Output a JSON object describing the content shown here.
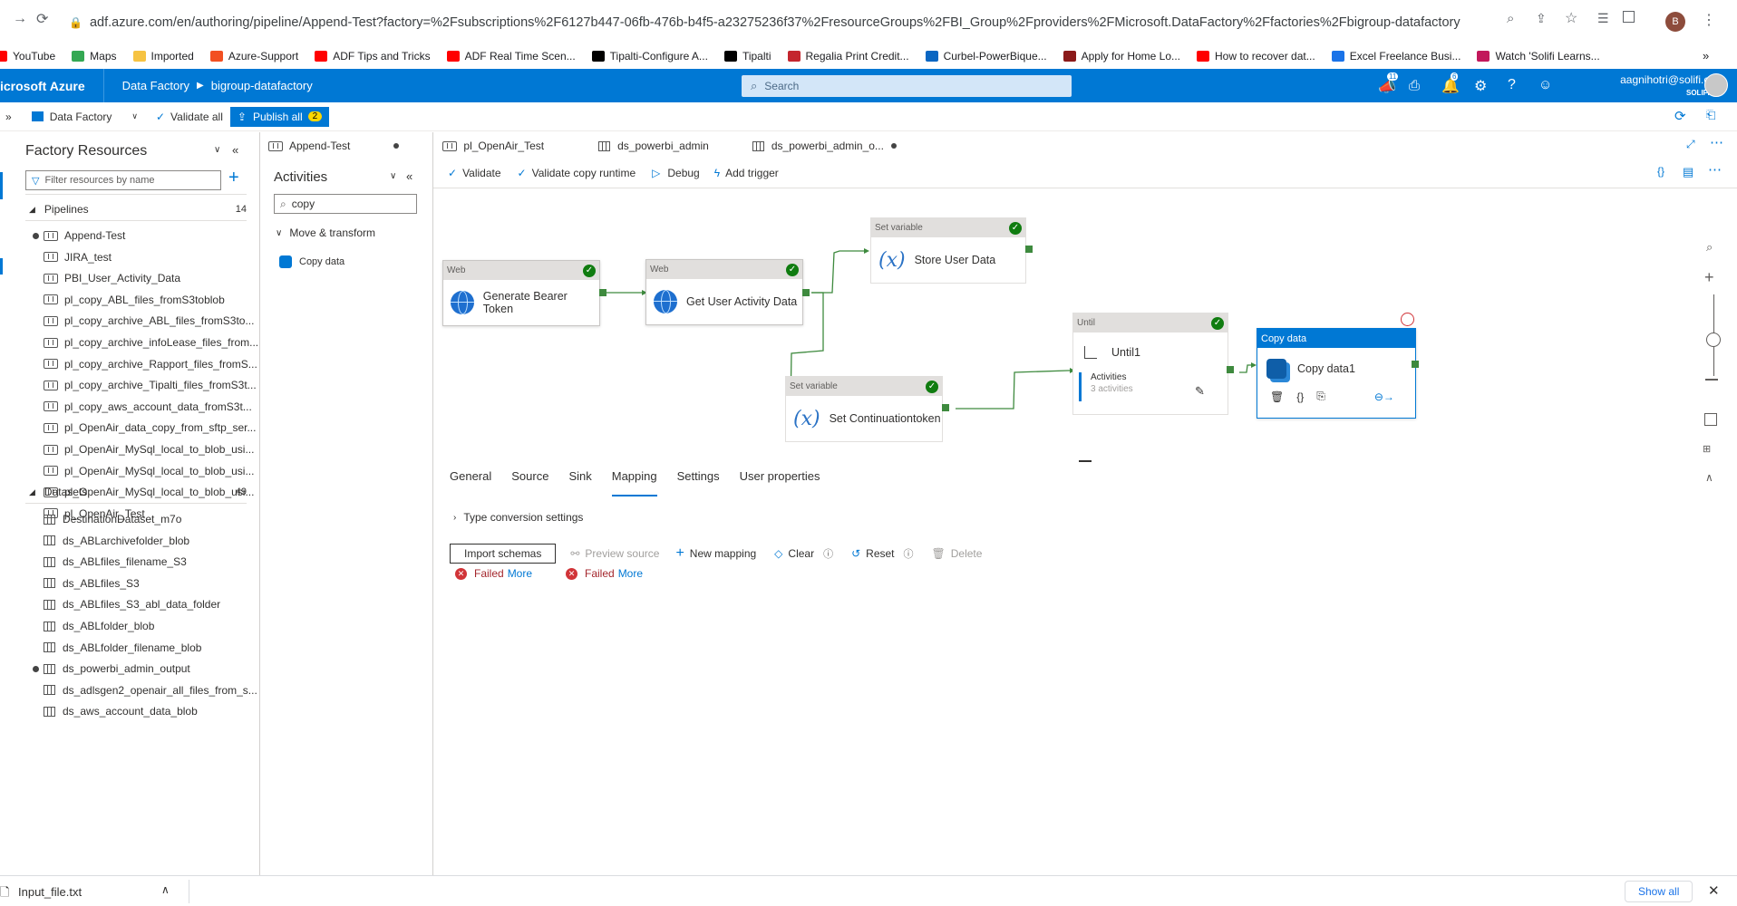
{
  "browser": {
    "url": "adf.azure.com/en/authoring/pipeline/Append-Test?factory=%2Fsubscriptions%2F6127b447-06fb-476b-b4f5-a23275236f37%2FresourceGroups%2FBI_Group%2Fproviders%2FMicrosoft.DataFactory%2Ffactories%2Fbigroup-datafactory",
    "profile_initial": "B",
    "bookmarks": [
      {
        "label": "YouTube",
        "color": "#ff0000"
      },
      {
        "label": "Maps",
        "color": "#34a853"
      },
      {
        "label": "Imported",
        "color": "#f6c342"
      },
      {
        "label": "Azure-Support",
        "color": "#f25022"
      },
      {
        "label": "ADF Tips and Tricks",
        "color": "#ff0000"
      },
      {
        "label": "ADF Real Time Scen...",
        "color": "#ff0000"
      },
      {
        "label": "Tipalti-Configure A...",
        "color": "#000000"
      },
      {
        "label": "Tipalti",
        "color": "#000000"
      },
      {
        "label": "Regalia Print Credit...",
        "color": "#c4262e"
      },
      {
        "label": "Curbel-PowerBique...",
        "color": "#0a66c2"
      },
      {
        "label": "Apply for Home Lo...",
        "color": "#8b1a1a"
      },
      {
        "label": "How to recover dat...",
        "color": "#ff0000"
      },
      {
        "label": "Excel Freelance Busi...",
        "color": "#1a73e8"
      },
      {
        "label": "Watch 'Solifi Learns...",
        "color": "#c2185b"
      }
    ]
  },
  "azure": {
    "brand": "icrosoft Azure",
    "breadcrumb": [
      "Data Factory",
      "bigroup-datafactory"
    ],
    "search_placeholder": "Search",
    "notif_count_1": "11",
    "notif_count_2": "6",
    "user_email": "aagnihotri@solifi.com",
    "user_org": "SOLIFI"
  },
  "toolbar": {
    "data_factory": "Data Factory",
    "validate_all": "Validate all",
    "publish_all": "Publish all",
    "publish_count": "2"
  },
  "factory": {
    "title": "Factory Resources",
    "filter_placeholder": "Filter resources by name",
    "pipelines_label": "Pipelines",
    "pipelines_count": "14",
    "pipelines": [
      "Append-Test",
      "JIRA_test",
      "PBI_User_Activity_Data",
      "pl_copy_ABL_files_fromS3toblob",
      "pl_copy_archive_ABL_files_fromS3to...",
      "pl_copy_archive_infoLease_files_from...",
      "pl_copy_archive_Rapport_files_fromS...",
      "pl_copy_archive_Tipalti_files_fromS3t...",
      "pl_copy_aws_account_data_fromS3t...",
      "pl_OpenAir_data_copy_from_sftp_ser...",
      "pl_OpenAir_MySql_local_to_blob_usi...",
      "pl_OpenAir_MySql_local_to_blob_usi...",
      "pl_OpenAir_MySql_local_to_blob_usi...",
      "pl_OpenAir_Test"
    ],
    "datasets_label": "Datasets",
    "datasets_count": "49",
    "datasets": [
      "DestinationDataset_m7o",
      "ds_ABLarchivefolder_blob",
      "ds_ABLfiles_filename_S3",
      "ds_ABLfiles_S3",
      "ds_ABLfiles_S3_abl_data_folder",
      "ds_ABLfolder_blob",
      "ds_ABLfolder_filename_blob",
      "ds_powerbi_admin_output",
      "ds_adlsgen2_openair_all_files_from_s...",
      "ds_aws_account_data_blob"
    ]
  },
  "activities": {
    "title": "Activities",
    "search_value": "copy",
    "group": "Move & transform",
    "item": "Copy data"
  },
  "tabs": [
    {
      "label": "Append-Test"
    },
    {
      "label": "pl_OpenAir_Test"
    },
    {
      "label": "ds_powerbi_admin"
    },
    {
      "label": "ds_powerbi_admin_o..."
    }
  ],
  "canvas_toolbar": {
    "validate": "Validate",
    "validate_copy": "Validate copy runtime",
    "debug": "Debug",
    "add_trigger": "Add trigger"
  },
  "nodes": {
    "web1": {
      "type": "Web",
      "name": "Generate Bearer Token"
    },
    "web2": {
      "type": "Web",
      "name": "Get User Activity Data"
    },
    "setvar1": {
      "type": "Set variable",
      "name": "Store User Data"
    },
    "setvar2": {
      "type": "Set variable",
      "name": "Set Continuationtoken"
    },
    "until": {
      "type": "Until",
      "name": "Until1",
      "activities_label": "Activities",
      "activities_count": "3 activities"
    },
    "copy": {
      "type": "Copy data",
      "name": "Copy data1"
    }
  },
  "properties": {
    "tabs": [
      "General",
      "Source",
      "Sink",
      "Mapping",
      "Settings",
      "User properties"
    ],
    "active_tab": "Mapping",
    "type_conversion": "Type conversion settings",
    "import_schemas": "Import schemas",
    "preview_source": "Preview source",
    "new_mapping": "New mapping",
    "clear": "Clear",
    "reset": "Reset",
    "delete": "Delete",
    "failed": "Failed",
    "more": "More"
  },
  "download": {
    "file": "Input_file.txt",
    "show_all": "Show all"
  },
  "colors": {
    "azure_blue": "#0078d4",
    "success_green": "#107c10",
    "error_red": "#d13438"
  }
}
